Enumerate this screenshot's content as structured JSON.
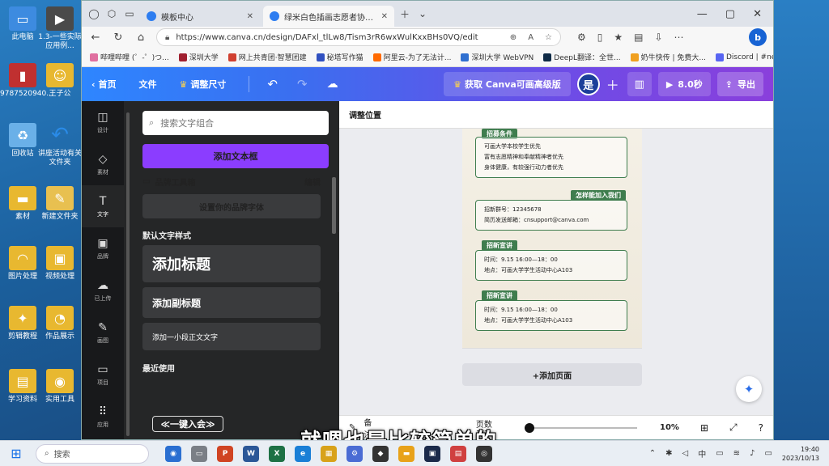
{
  "desktop": {
    "icons": [
      {
        "label": "此电脑",
        "icon": "computer-icon",
        "color": "#3d8be0"
      },
      {
        "label": "1.3-一些实际 应用例...",
        "icon": "video-file-icon",
        "color": "#4a4a4a"
      },
      {
        "label": "9787520940...",
        "icon": "book-file-icon",
        "color": "#c03030"
      },
      {
        "label": "王子公",
        "icon": "user-folder-icon",
        "color": "#e8b830"
      },
      {
        "label": "回收站",
        "icon": "recycle-bin-icon",
        "color": "#6ab0e8"
      },
      {
        "label": "讲座活动有关文件夹",
        "icon": "undo-arrow-icon",
        "color": "#2a8be8"
      },
      {
        "label": "素材",
        "icon": "folder-icon",
        "color": "#e8b830"
      },
      {
        "label": "新建文件夹",
        "icon": "folder-icon",
        "color": "#e8c050"
      },
      {
        "label": "图片处理",
        "icon": "folder-icon",
        "color": "#e8b830"
      },
      {
        "label": "视频处理",
        "icon": "folder-icon",
        "color": "#e8b830"
      },
      {
        "label": "剪辑教程",
        "icon": "folder-icon",
        "color": "#e8b830"
      },
      {
        "label": "作品展示",
        "icon": "folder-icon",
        "color": "#e8b830"
      },
      {
        "label": "学习资料",
        "icon": "folder-icon",
        "color": "#e8b830"
      },
      {
        "label": "实用工具",
        "icon": "folder-icon",
        "color": "#e8b830"
      }
    ]
  },
  "browser": {
    "tabs": [
      {
        "label": "模板中心",
        "active": false
      },
      {
        "label": "绿米白色插画志愿者协会招新海...",
        "active": true
      }
    ],
    "url": "https://www.canva.cn/design/DAFxl_tlLw8/Tism3rR6wxWulKxxBHs0VQ/edit",
    "bookmarks": [
      {
        "label": "哔哩哔哩 (゜-゜)つ...",
        "color": "#e070a0"
      },
      {
        "label": "深圳大学",
        "color": "#a02030"
      },
      {
        "label": "网上共青团·智慧团建",
        "color": "#d04030"
      },
      {
        "label": "秘塔写作猫",
        "color": "#3050c0"
      },
      {
        "label": "阿里云-为了无法计...",
        "color": "#ff6a00"
      },
      {
        "label": "深圳大学 WebVPN",
        "color": "#3070d0"
      },
      {
        "label": "DeepL翻译：全世...",
        "color": "#0f2b46"
      },
      {
        "label": "奶牛快传 | 免费大...",
        "color": "#f0a020"
      },
      {
        "label": "Discord | #newbie...",
        "color": "#5865f2"
      }
    ]
  },
  "canva": {
    "header": {
      "home": "首页",
      "file": "文件",
      "resize": "调整尺寸",
      "upgrade": "获取 Canva可画高级版",
      "avatar": "是",
      "duration": "8.0秒",
      "share": "导出"
    },
    "rail": [
      {
        "label": "设计",
        "icon": "layout-icon"
      },
      {
        "label": "素材",
        "icon": "shapes-icon"
      },
      {
        "label": "文字",
        "icon": "text-icon"
      },
      {
        "label": "品牌",
        "icon": "brand-icon"
      },
      {
        "label": "已上传",
        "icon": "upload-icon"
      },
      {
        "label": "画图",
        "icon": "draw-icon"
      },
      {
        "label": "项目",
        "icon": "folder-icon"
      },
      {
        "label": "应用",
        "icon": "apps-icon"
      }
    ],
    "panel": {
      "search_placeholder": "搜索文字组合",
      "add_textbox": "添加文本框",
      "brand_kit": "品牌工具箱",
      "edit": "编辑",
      "set_brand_font": "设置你的品牌字体",
      "default_styles": "默认文字样式",
      "add_heading": "添加标题",
      "add_subheading": "添加副标题",
      "add_body": "添加一小段正文文字",
      "recent": "最近使用",
      "join_label": "≪一键入会≫"
    },
    "context_bar": "调整位置",
    "page": {
      "sections": [
        {
          "title": "招募条件",
          "lines": [
            "可画大学本校学生优先",
            "富有志愿精神和奉献精神者优先",
            "身体健康，有较强行动力者优先"
          ]
        },
        {
          "title": "怎样能加入我们",
          "lines": [
            "招新群号：12345678",
            "简历发送邮箱：cnsupport@canva.com"
          ]
        },
        {
          "title": "招新宣讲",
          "lines": [
            "时间：9.15 16:00—18：00",
            "地点：可画大学学生活动中心A103"
          ]
        },
        {
          "title": "招新宣讲",
          "lines": [
            "时间：9.15 16:00—18：00",
            "地点：可画大学学生活动中心A103"
          ]
        }
      ]
    },
    "add_page": "+添加页面",
    "footer": {
      "notes": "备注",
      "pages": "页数 1/1",
      "zoom": "10%"
    }
  },
  "subtitle": "就嗯也是比较简单的",
  "taskbar": {
    "search": "搜索",
    "ime": "中",
    "time": "19:40",
    "date": "2023/10/13"
  }
}
